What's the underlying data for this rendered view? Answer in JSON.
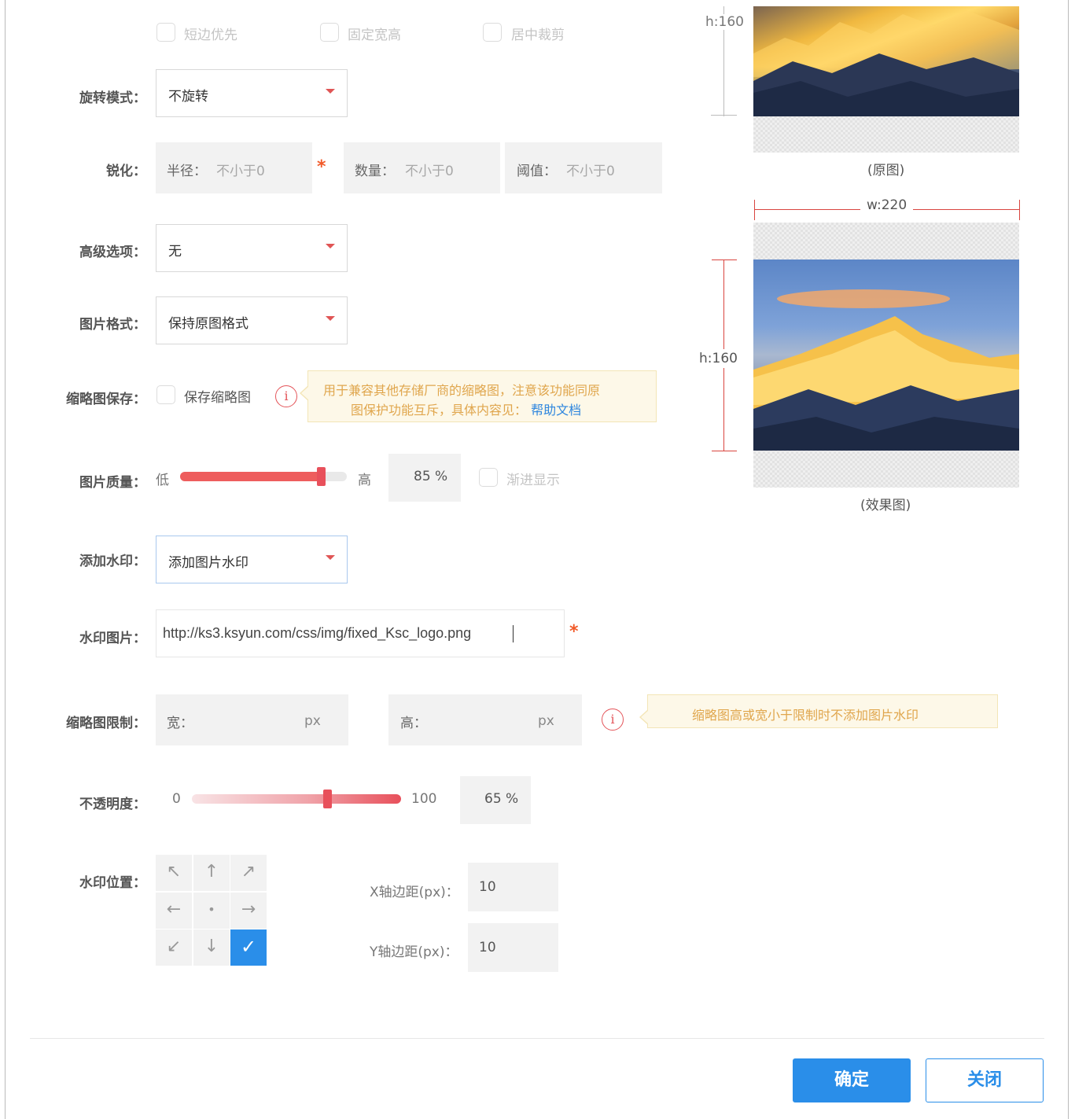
{
  "crop_options": [
    {
      "label": "短边优先"
    },
    {
      "label": "固定宽高"
    },
    {
      "label": "居中裁剪"
    }
  ],
  "rotate": {
    "label": "旋转模式：",
    "value": "不旋转"
  },
  "sharpen": {
    "label": "锐化：",
    "radius": {
      "key": "半径：",
      "placeholder": "不小于0"
    },
    "amount": {
      "key": "数量：",
      "placeholder": "不小于0"
    },
    "threshold": {
      "key": "阈值：",
      "placeholder": "不小于0"
    },
    "required_mark": "*"
  },
  "advanced": {
    "label": "高级选项：",
    "value": "无"
  },
  "format": {
    "label": "图片格式：",
    "value": "保持原图格式"
  },
  "thumb_save": {
    "label": "缩略图保存：",
    "checkbox_label": "保存缩略图",
    "tip_line1": "用于兼容其他存储厂商的缩略图，注意该功能同原",
    "tip_line2": "图保护功能互斥，具体内容见：",
    "tip_link": "帮助文档"
  },
  "quality": {
    "label": "图片质量：",
    "low": "低",
    "high": "高",
    "value_text": "85 %",
    "value": 85,
    "progressive_label": "渐进显示"
  },
  "watermark": {
    "label": "添加水印：",
    "value": "添加图片水印"
  },
  "watermark_image": {
    "label": "水印图片：",
    "value": "http://ks3.ksyun.com/css/img/fixed_Ksc_logo.png",
    "required_mark": "*"
  },
  "thumb_limit": {
    "label": "缩略图限制：",
    "width_key": "宽：",
    "height_key": "高：",
    "unit": "px",
    "tip": "缩略图高或宽小于限制时不添加图片水印"
  },
  "opacity": {
    "label": "不透明度：",
    "min": "0",
    "max": "100",
    "value_text": "65 %",
    "value": 65
  },
  "position": {
    "label": "水印位置：",
    "cells": [
      "↖",
      "↑",
      "↗",
      "←",
      "•",
      "→",
      "↙",
      "↓",
      "✓"
    ],
    "selected_index": 8,
    "x_label": "X轴边距(px)：",
    "x_value": "10",
    "y_label": "Y轴边距(px)：",
    "y_value": "10"
  },
  "preview": {
    "original_height": "h:160",
    "original_caption": "(原图)",
    "effect_width": "w:220",
    "effect_height": "h:160",
    "effect_caption": "(效果图)"
  },
  "buttons": {
    "confirm": "确定",
    "close": "关闭"
  },
  "colors": {
    "primary": "#2a8ee9",
    "accent_red": "#e8505b",
    "required": "#f15a29",
    "tip_bg": "#fdf8e8"
  }
}
